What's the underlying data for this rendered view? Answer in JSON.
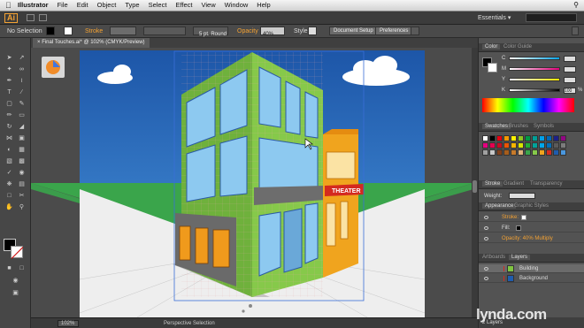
{
  "menubar": {
    "apple": "",
    "app": "Illustrator",
    "items": [
      "File",
      "Edit",
      "Object",
      "Type",
      "Select",
      "Effect",
      "View",
      "Window",
      "Help"
    ]
  },
  "appbar": {
    "logo": "Ai",
    "workspace": "Essentials",
    "workspace_arrow": "▾"
  },
  "control": {
    "selection": "No Selection",
    "stroke_label": "Stroke",
    "brush": "5 pt. Round",
    "opacity_label": "Opacity",
    "opacity": "40%",
    "style_label": "Style:",
    "doc_setup": "Document Setup",
    "preferences": "Preferences"
  },
  "document": {
    "tab_title": "Final Touches.ai* @ 102% (CMYK/Preview)",
    "close": "×"
  },
  "status": {
    "zoom": "102%",
    "tool": "Perspective Selection"
  },
  "color_panel": {
    "tabs": [
      "Color",
      "Color Guide"
    ],
    "channels": [
      {
        "name": "C",
        "value": ""
      },
      {
        "name": "M",
        "value": ""
      },
      {
        "name": "Y",
        "value": ""
      },
      {
        "name": "K",
        "value": "100"
      }
    ],
    "k_suffix": "%"
  },
  "swatches_panel": {
    "tabs": [
      "Swatches",
      "Brushes",
      "Symbols"
    ]
  },
  "stroke_panel": {
    "tabs": [
      "Stroke",
      "Gradient",
      "Transparency"
    ],
    "weight_label": "Weight:"
  },
  "appearance_panel": {
    "tabs": [
      "Appearance",
      "Graphic Styles"
    ],
    "stroke": "Stroke:",
    "fill": "Fill:",
    "opacity": "Opacity: 40% Multiply"
  },
  "layers_panel": {
    "tabs": [
      "Artboards",
      "Layers"
    ],
    "layers": [
      {
        "name": "Building"
      },
      {
        "name": "Background"
      }
    ],
    "count": "2 Layers"
  },
  "sign": {
    "theater": "THEATER"
  },
  "watermark": {
    "brand": "lynda.com"
  },
  "colors": {
    "sky_top": "#1f5cae",
    "sky_bottom": "#3c8bd8",
    "ground_green": "#3aa54b",
    "building_green": "#7fc440",
    "theater_orange": "#f0a41e",
    "accent_red": "#d42a1f"
  }
}
